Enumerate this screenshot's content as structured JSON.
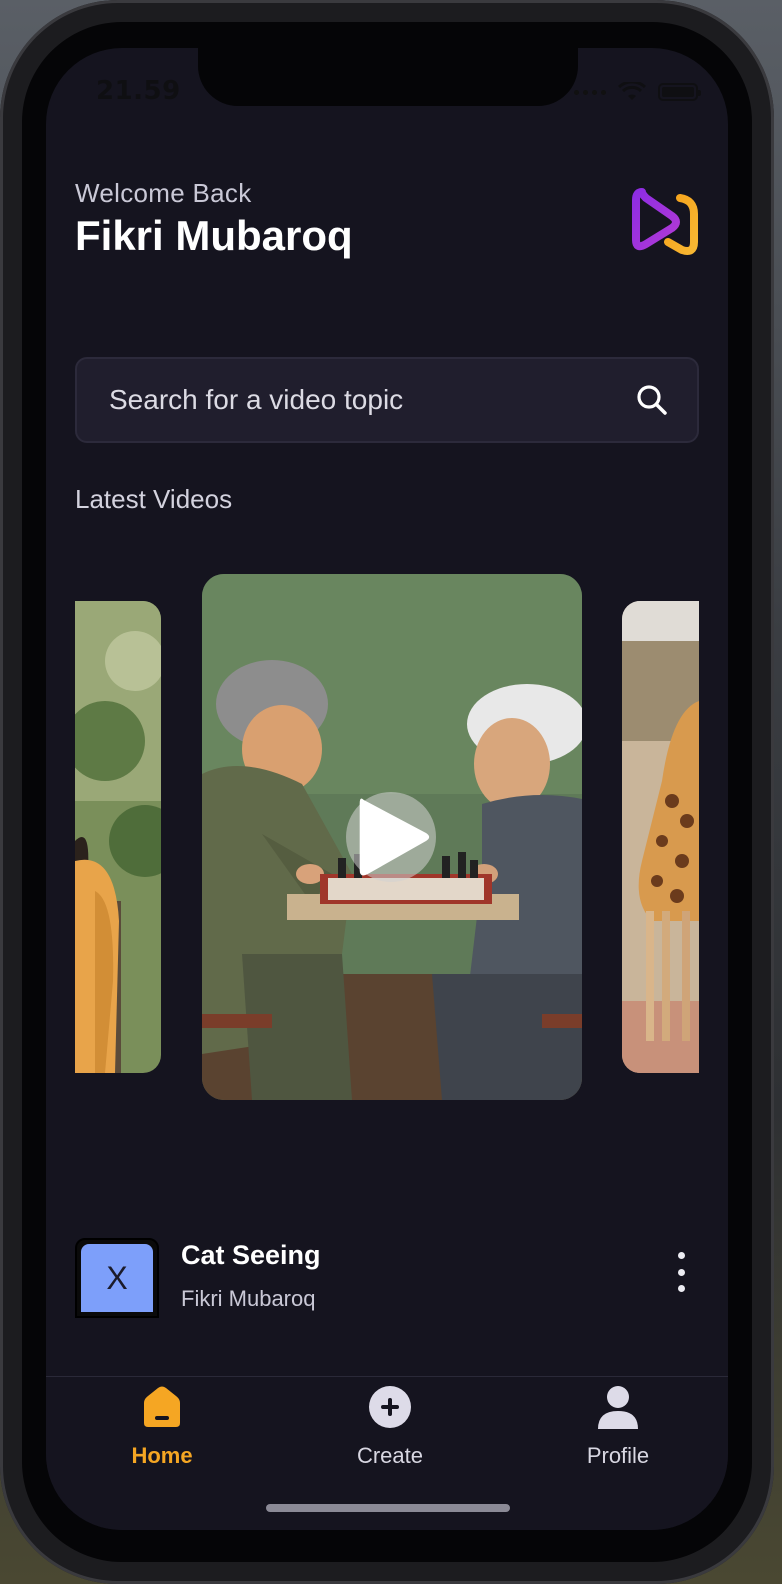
{
  "status_bar": {
    "time": "21.59"
  },
  "header": {
    "greeting": "Welcome Back",
    "username": "Fikri Mubaroq",
    "logo_icon": "app-logo-icon"
  },
  "search": {
    "placeholder": "Search for a video topic",
    "icon": "search-icon"
  },
  "latest_videos": {
    "title": "Latest Videos",
    "carousel": [
      {
        "id": "left",
        "scene": "woman in yellow sweater outdoors"
      },
      {
        "id": "main",
        "scene": "two elderly men playing chess"
      },
      {
        "id": "right",
        "scene": "giraffe in savanna"
      }
    ]
  },
  "video_list": [
    {
      "thumbnail_text": "X",
      "title": "Cat Seeing",
      "author": "Fikri Mubaroq"
    }
  ],
  "bottom_nav": {
    "items": [
      {
        "label": "Home",
        "icon": "home-icon",
        "active": true
      },
      {
        "label": "Create",
        "icon": "plus-circle-icon",
        "active": false
      },
      {
        "label": "Profile",
        "icon": "user-icon",
        "active": false
      }
    ]
  },
  "colors": {
    "background": "#15141f",
    "accent": "#f5a623",
    "search_bg": "#201e2d",
    "thumbnail_bg": "#7d9ffa",
    "logo_purple": "#9b3bd6",
    "logo_orange": "#f6a21a"
  }
}
